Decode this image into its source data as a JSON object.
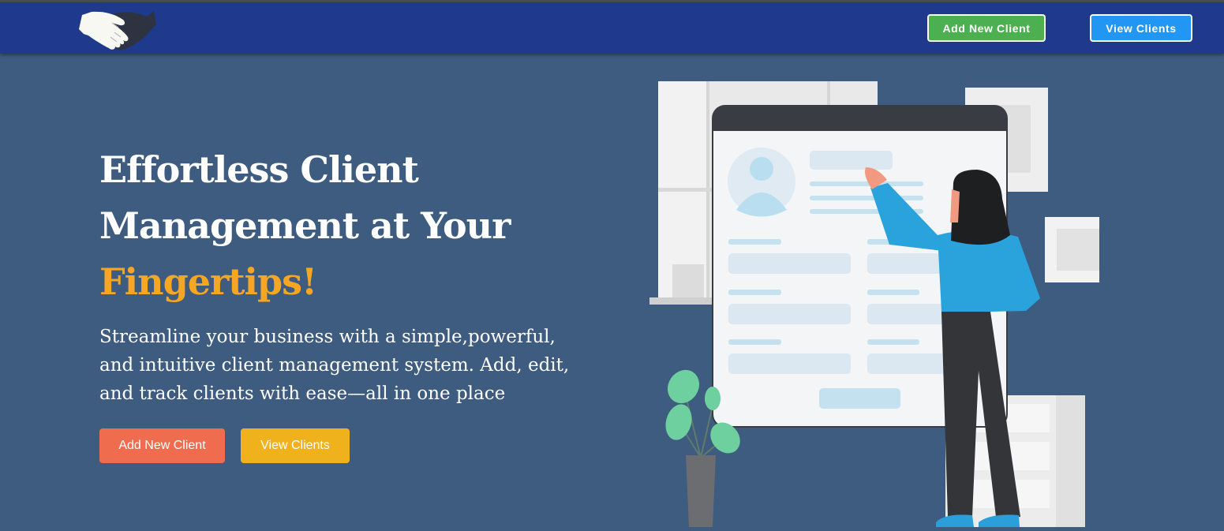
{
  "navbar": {
    "logo_icon": "handshake-icon",
    "add_label": "Add New Client",
    "view_label": "View Clients"
  },
  "hero": {
    "title_line1": "Effortless Client",
    "title_line2": "Management at Your",
    "title_accent": "Fingertips!",
    "subtitle": "Streamline your business with a simple,powerful, and intuitive client management system. Add, edit, and track clients with ease—all in one place",
    "add_label": "Add New Client",
    "view_label": "View Clients"
  },
  "colors": {
    "navbar": "#1f3a8c",
    "background": "#3e5b80",
    "accent": "#f5a623",
    "nav_add": "#4caf50",
    "nav_view": "#2196f3",
    "hero_add": "#ef6c4f",
    "hero_view": "#f0b21c"
  }
}
